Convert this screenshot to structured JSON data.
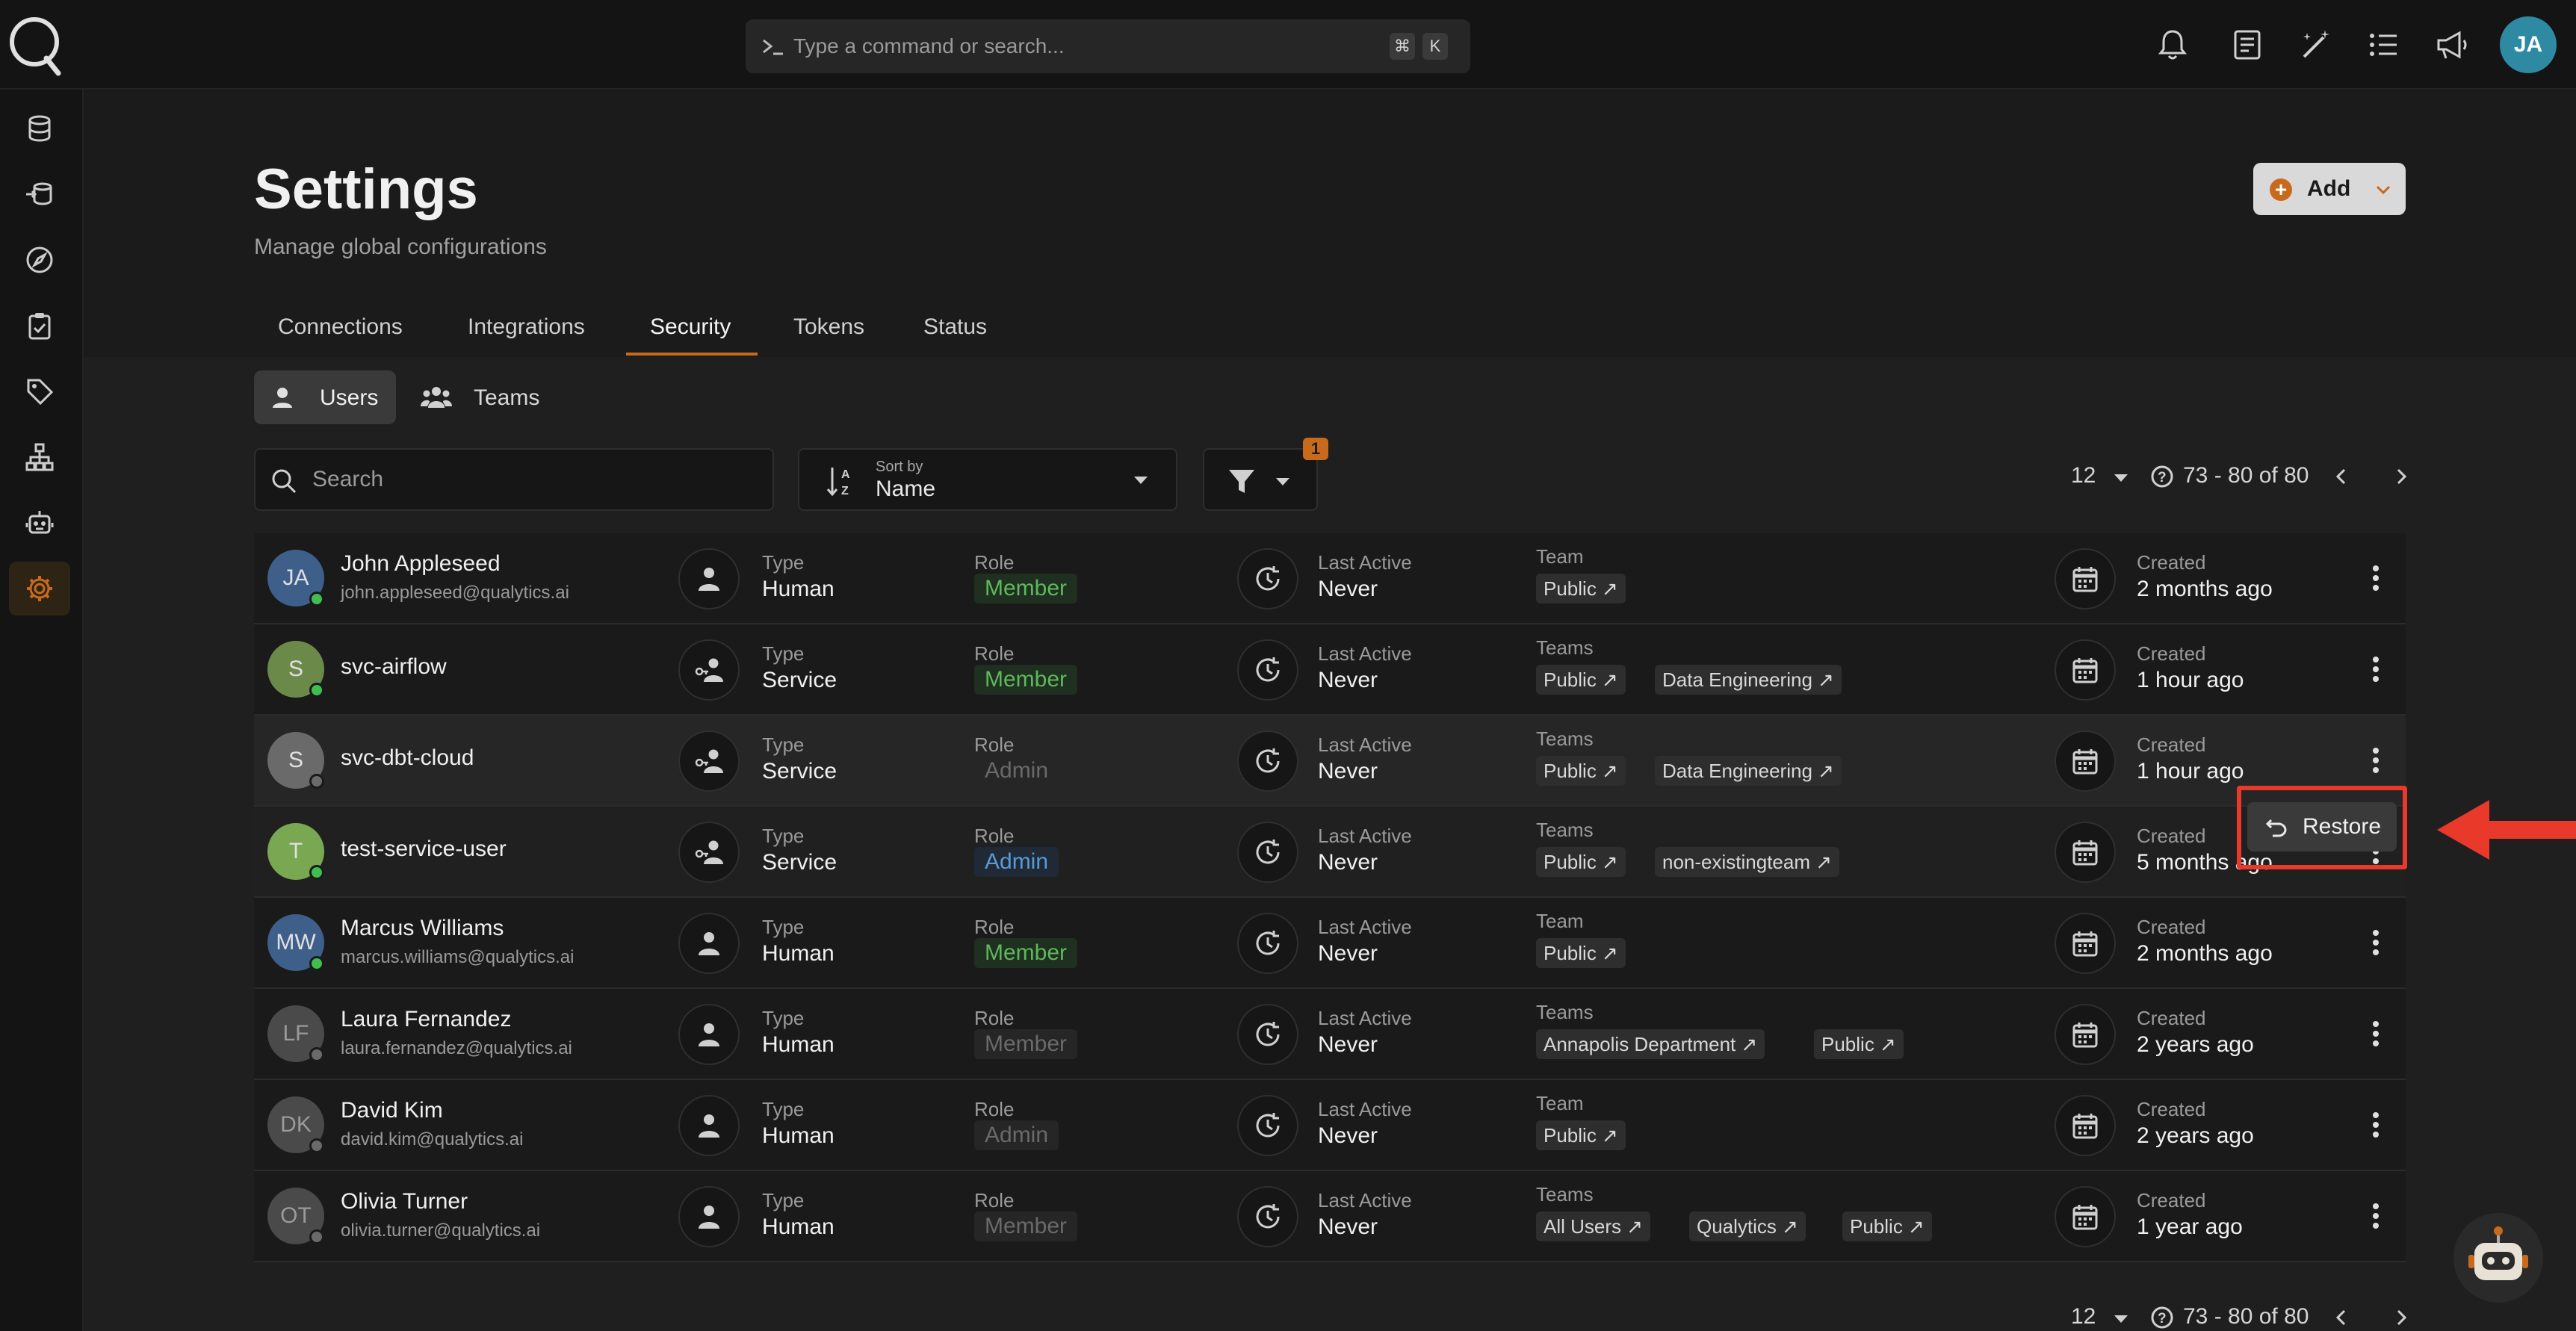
{
  "search_bar": {
    "placeholder": "Type a command or search...",
    "shortcut_keys": [
      "⌘",
      "K"
    ]
  },
  "user_avatar": "JA",
  "header": {
    "title": "Settings",
    "subtitle": "Manage global configurations",
    "add_label": "Add"
  },
  "tabs": [
    {
      "label": "Connections"
    },
    {
      "label": "Integrations"
    },
    {
      "label": "Security",
      "active": true
    },
    {
      "label": "Tokens"
    },
    {
      "label": "Status"
    }
  ],
  "segments": {
    "users": "Users",
    "teams": "Teams"
  },
  "toolbar": {
    "search_placeholder": "Search",
    "sort_caption": "Sort by",
    "sort_value": "Name",
    "filter_count": "1"
  },
  "pagination": {
    "page_size": "12",
    "range": "73 - 80 of 80"
  },
  "labels": {
    "type": "Type",
    "role": "Role",
    "last_active": "Last Active",
    "team": "Team",
    "teams": "Teams",
    "created": "Created"
  },
  "users": [
    {
      "initials": "JA",
      "name": "John Appleseed",
      "email": "john.appleseed@qualytics.ai",
      "type": "Human",
      "role": "Member",
      "last_active": "Never",
      "team_label": "Team",
      "teams": [
        "Public"
      ],
      "created": "2 months ago"
    },
    {
      "initials": "S",
      "name": "svc-airflow",
      "email": "",
      "type": "Service",
      "role": "Member",
      "last_active": "Never",
      "team_label": "Teams",
      "teams": [
        "Public",
        "Data Engineering"
      ],
      "created": "1 hour ago"
    },
    {
      "initials": "S",
      "name": "svc-dbt-cloud",
      "email": "",
      "type": "Service",
      "role": "Admin",
      "last_active": "Never",
      "team_label": "Teams",
      "teams": [
        "Public",
        "Data Engineering"
      ],
      "created": "1 hour ago"
    },
    {
      "initials": "T",
      "name": "test-service-user",
      "email": "",
      "type": "Service",
      "role": "Admin",
      "last_active": "Never",
      "team_label": "Teams",
      "teams": [
        "Public",
        "non-existingteam"
      ],
      "created": "5 months ago"
    },
    {
      "initials": "MW",
      "name": "Marcus Williams",
      "email": "marcus.williams@qualytics.ai",
      "type": "Human",
      "role": "Member",
      "last_active": "Never",
      "team_label": "Team",
      "teams": [
        "Public"
      ],
      "created": "2 months ago"
    },
    {
      "initials": "LF",
      "name": "Laura Fernandez",
      "email": "laura.fernandez@qualytics.ai",
      "type": "Human",
      "role": "Member",
      "last_active": "Never",
      "team_label": "Teams",
      "teams": [
        "Annapolis Department",
        "Public"
      ],
      "created": "2 years ago"
    },
    {
      "initials": "DK",
      "name": "David Kim",
      "email": "david.kim@qualytics.ai",
      "type": "Human",
      "role": "Admin",
      "last_active": "Never",
      "team_label": "Team",
      "teams": [
        "Public"
      ],
      "created": "2 years ago"
    },
    {
      "initials": "OT",
      "name": "Olivia Turner",
      "email": "olivia.turner@qualytics.ai",
      "type": "Human",
      "role": "Member",
      "last_active": "Never",
      "team_label": "Teams",
      "teams": [
        "All Users",
        "Qualytics",
        "Public"
      ],
      "created": "1 year ago"
    }
  ],
  "row_menu": {
    "restore_label": "Restore"
  },
  "colors": {
    "accent": "#c86a1c",
    "annotation": "#e8392a",
    "member": "#5fb85c",
    "admin": "#5a9ad6",
    "online": "#3fbf4f",
    "offline": "#6a6a6a"
  }
}
